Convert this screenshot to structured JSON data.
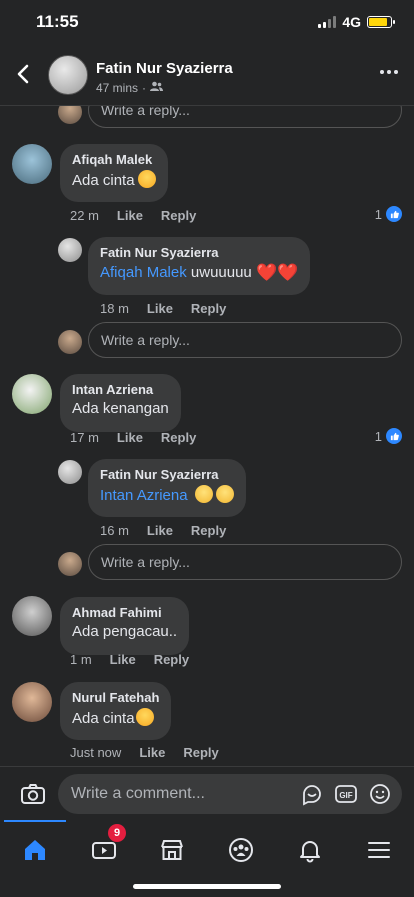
{
  "status": {
    "time": "11:55",
    "network": "4G"
  },
  "header": {
    "name": "Fatin Nur Syazierra",
    "time": "47 mins",
    "separator": "·"
  },
  "reply_placeholder": "Write a reply...",
  "comments": [
    {
      "author": "Afiqah Malek",
      "text": "Ada cinta",
      "time": "22 m",
      "like_label": "Like",
      "reply_label": "Reply",
      "likes": "1",
      "reply": {
        "author": "Fatin Nur Syazierra",
        "mention": "Afiqah Malek",
        "text": "uwuuuuu",
        "time": "18 m",
        "like_label": "Like",
        "reply_label": "Reply"
      }
    },
    {
      "author": "Intan Azriena",
      "text": "Ada kenangan",
      "time": "17 m",
      "like_label": "Like",
      "reply_label": "Reply",
      "likes": "1",
      "reply": {
        "author": "Fatin Nur Syazierra",
        "mention": "Intan Azriena",
        "text": "",
        "time": "16 m",
        "like_label": "Like",
        "reply_label": "Reply"
      }
    },
    {
      "author": "Ahmad Fahimi",
      "text": "Ada pengacau..",
      "time": "1 m",
      "like_label": "Like",
      "reply_label": "Reply"
    },
    {
      "author": "Nurul Fatehah",
      "text": "Ada cinta",
      "time": "Just now",
      "like_label": "Like",
      "reply_label": "Reply"
    }
  ],
  "composer": {
    "placeholder": "Write a comment..."
  },
  "tabbar": {
    "video_badge": "9"
  },
  "colors": {
    "accent": "#2d88ff",
    "mention": "#4599ff",
    "badge": "#e41e3f",
    "bubble": "#3a3b3c",
    "background": "#242526"
  }
}
